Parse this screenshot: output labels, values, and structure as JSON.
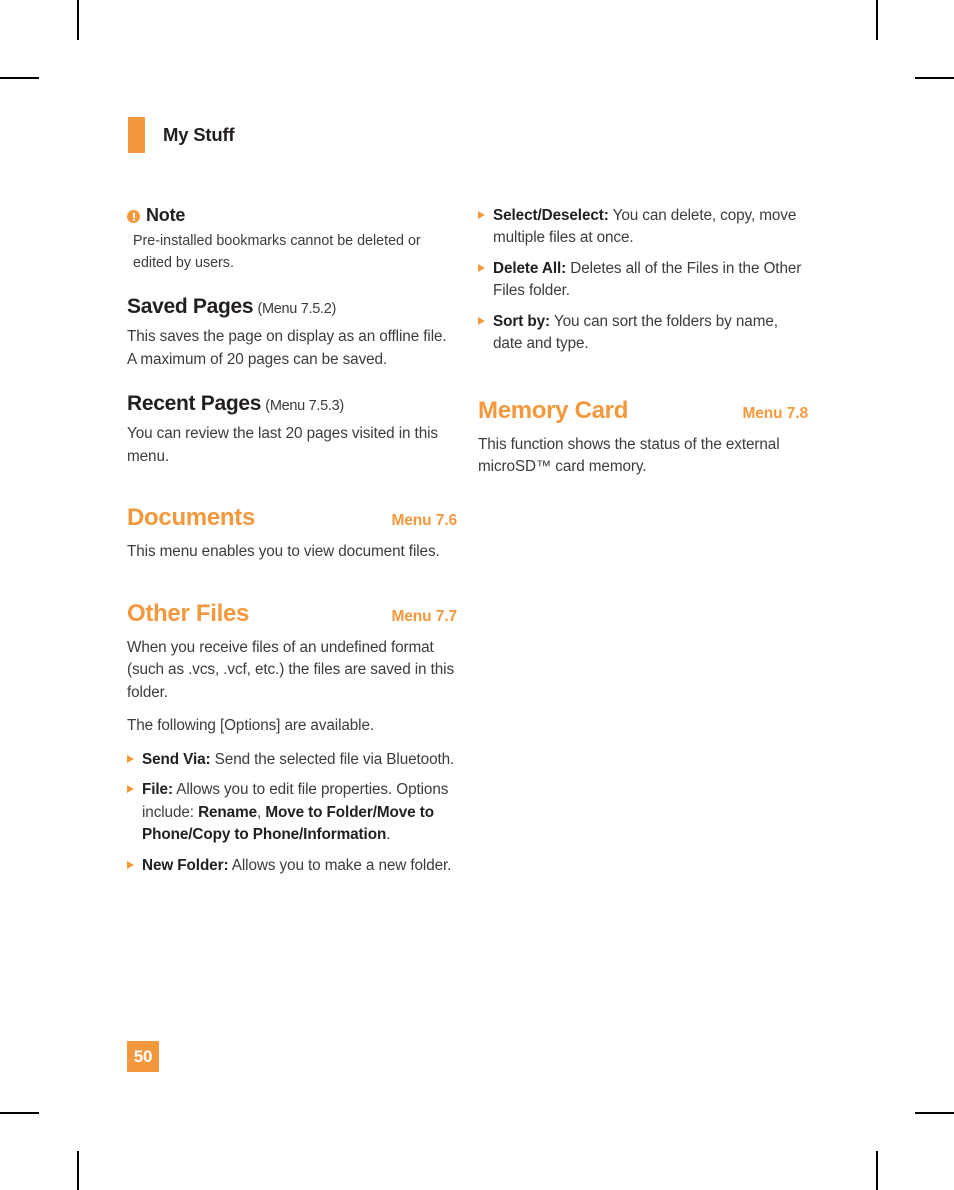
{
  "running_head": {
    "title": "My Stuff"
  },
  "left_column": {
    "note": {
      "icon": "exclamation-circle-icon",
      "title": "Note",
      "body": "Pre-installed bookmarks cannot be deleted or edited by users."
    },
    "saved_pages": {
      "name": "Saved Pages",
      "ref": "(Menu 7.5.2)",
      "body": "This saves the page on display as an offline file. A maximum of 20 pages can be saved."
    },
    "recent_pages": {
      "name": "Recent Pages",
      "ref": "(Menu 7.5.3)",
      "body": "You can review the last 20 pages visited in this menu."
    },
    "documents": {
      "name": "Documents",
      "menu_number": "Menu 7.6",
      "body": "This menu enables you to view document files."
    },
    "other_files": {
      "name": "Other Files",
      "menu_number": "Menu 7.7",
      "body1": "When you receive files of an undefined format (such as .vcs, .vcf, etc.) the files are saved in this folder.",
      "body2": "The following [Options] are available.",
      "options": [
        {
          "label": "Send Via:",
          "text": " Send the selected file via Bluetooth.",
          "emphasis": []
        },
        {
          "label": "File:",
          "text": " Allows you to edit file properties. Options include: ",
          "emphasis": [
            "Rename",
            "Move to Folder/Move to Phone/Copy to Phone/Information"
          ],
          "separator": ", ",
          "tail": "."
        },
        {
          "label": "New Folder:",
          "text": " Allows you to make a new folder.",
          "emphasis": []
        }
      ]
    }
  },
  "right_column": {
    "options": [
      {
        "label": "Select/Deselect:",
        "text": " You can delete, copy, move multiple files at once."
      },
      {
        "label": "Delete All:",
        "text": " Deletes all of the Files in the Other Files folder."
      },
      {
        "label": "Sort by:",
        "text": " You can sort the folders by name, date and type."
      }
    ],
    "memory_card": {
      "name": "Memory Card",
      "menu_number": "Menu 7.8",
      "body": "This function shows the status of the external microSD™ card memory."
    }
  },
  "footer": {
    "page_number": "50"
  },
  "colors": {
    "accent": "#F3983C",
    "heading": "#231f20",
    "body": "#3c3c3c"
  }
}
